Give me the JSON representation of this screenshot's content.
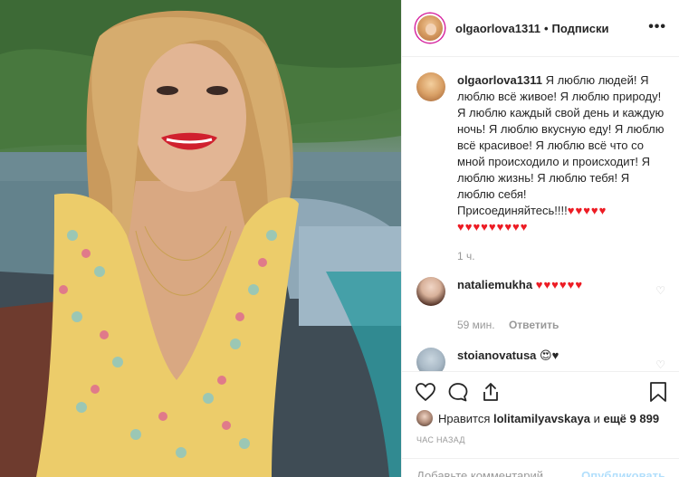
{
  "post": {
    "author": "olgaorlova1311",
    "follow_label": "Подписки",
    "more_label": "•••",
    "caption_line_1": "Я люблю людей! Я люблю всё живое! Я люблю природу! Я люблю каждый свой день и каждую ночь! Я люблю вкусную еду! Я люблю всё красивое! Я люблю всё что со мной происходило и происходит! Я люблю жизнь! Я люблю тебя! Я люблю себя!",
    "caption_line_2": "Присоединяйтесь!!!!",
    "caption_hearts_a": "♥♥♥♥♥",
    "caption_hearts_b": "♥♥♥♥♥♥♥♥♥",
    "caption_time": "1 ч."
  },
  "comments": [
    {
      "user": "nataliemukha",
      "hearts": "♥♥♥♥♥♥",
      "time": "59 мин.",
      "reply_label": "Ответить"
    },
    {
      "user": "stoianovatusa",
      "emoji": "😍♥"
    }
  ],
  "likes": {
    "prefix": "Нравится",
    "user": "lolitamilyavskaya",
    "suffix_and": "и",
    "suffix_count": "ещё 9 899"
  },
  "timestamp": "ЧАС НАЗАД",
  "composer": {
    "placeholder": "Добавьте комментарий...",
    "publish_label": "Опубликовать"
  },
  "icons": {
    "heart": "heart-icon",
    "comment": "comment-icon",
    "share": "share-icon",
    "bookmark": "bookmark-icon",
    "like_small": "heart-small-icon"
  },
  "colors": {
    "heart_red": "#ed1c24",
    "muted": "#999999",
    "text": "#262626"
  }
}
